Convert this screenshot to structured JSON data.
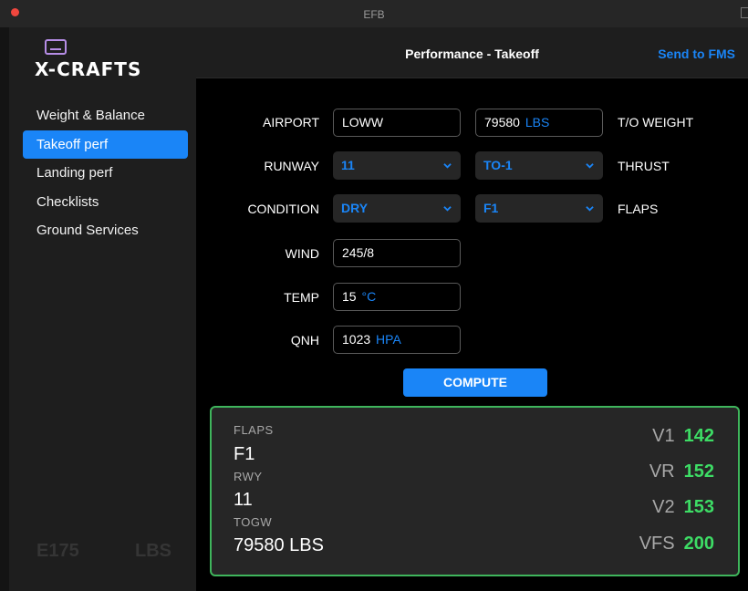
{
  "window": {
    "title": "EFB"
  },
  "sidebar": {
    "logo_text": "X-CRAFTS",
    "items": [
      {
        "label": "Weight & Balance"
      },
      {
        "label": "Takeoff perf",
        "active": true
      },
      {
        "label": "Landing perf"
      },
      {
        "label": "Checklists"
      },
      {
        "label": "Ground Services"
      }
    ],
    "aircraft": "E175",
    "units": "LBS"
  },
  "header": {
    "title": "Performance - Takeoff",
    "send_label": "Send to FMS"
  },
  "form": {
    "airport": {
      "label": "AIRPORT",
      "value": "LOWW"
    },
    "weight": {
      "label": "T/O WEIGHT",
      "value": "79580",
      "unit": "LBS"
    },
    "runway": {
      "label": "RUNWAY",
      "value": "11"
    },
    "thrust": {
      "label": "THRUST",
      "value": "TO-1"
    },
    "condition": {
      "label": "CONDITION",
      "value": "DRY"
    },
    "flaps": {
      "label": "FLAPS",
      "value": "F1"
    },
    "wind": {
      "label": "WIND",
      "value": "245/8"
    },
    "temp": {
      "label": "TEMP",
      "value": "15",
      "unit": "°C"
    },
    "qnh": {
      "label": "QNH",
      "value": "1023",
      "unit": "HPA"
    },
    "compute_label": "COMPUTE"
  },
  "result": {
    "flaps_label": "FLAPS",
    "flaps_value": "F1",
    "rwy_label": "RWY",
    "rwy_value": "11",
    "togw_label": "TOGW",
    "togw_value": "79580 LBS",
    "speeds": [
      {
        "name": "V1",
        "value": "142"
      },
      {
        "name": "VR",
        "value": "152"
      },
      {
        "name": "V2",
        "value": "153"
      },
      {
        "name": "VFS",
        "value": "200"
      }
    ]
  },
  "colors": {
    "accent": "#1a85f7",
    "success": "#3ddc65",
    "logo": "#b68de6"
  }
}
